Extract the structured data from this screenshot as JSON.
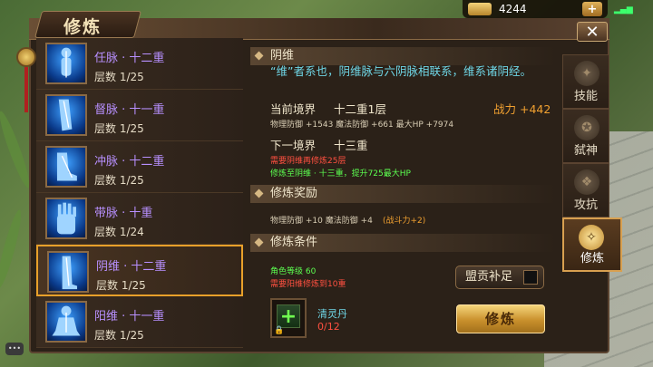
{
  "resources": {
    "gold_value": "4244",
    "plus_label": "+"
  },
  "window": {
    "title": "修炼",
    "close_label": "✕"
  },
  "meridians": [
    {
      "name": "任脉 · 十二重",
      "layer": "层数 1/25",
      "icon": "body-figure"
    },
    {
      "name": "督脉 · 十一重",
      "layer": "层数 1/25",
      "icon": "leg-figure"
    },
    {
      "name": "冲脉 · 十二重",
      "layer": "层数 1/25",
      "icon": "foot-figure"
    },
    {
      "name": "带脉 · 十重",
      "layer": "层数 1/24",
      "icon": "hand-figure"
    },
    {
      "name": "阴维 · 十二重",
      "layer": "层数 1/25",
      "icon": "leg-figure",
      "selected": true
    },
    {
      "name": "阳维 · 十一重",
      "layer": "层数 1/25",
      "icon": "seated-figure"
    }
  ],
  "detail": {
    "section_title": "阴维",
    "description": "“维”者系也，阴维脉与六阴脉相联系，维系诸阴经。",
    "current_label": "当前境界",
    "current_value": "十二重1层",
    "power_label": "战力 +442",
    "current_stats": "物理防御 +1543  魔法防御 +661  最大HP +7974",
    "next_label": "下一境界",
    "next_value": "十三重",
    "requirement": "需要阴维再修炼25层",
    "next_bonus": "修炼至阴维 · 十三重，提升725最大HP"
  },
  "reward": {
    "section_title": "修炼奖励",
    "stats": "物理防御 +10  魔法防御 +4",
    "power": "(战斗力+2)"
  },
  "condition": {
    "section_title": "修炼条件",
    "level": "角色等级  60",
    "requirement": "需要阳维修炼到10重",
    "item_name": "清灵丹",
    "item_count": "0/12",
    "item_slot_plus": "+"
  },
  "buttons": {
    "supplement": "盟贡补足",
    "cultivate": "修炼"
  },
  "tabs": [
    {
      "label": "技能",
      "icon": "skill-icon"
    },
    {
      "label": "弑神",
      "icon": "godslayer-icon"
    },
    {
      "label": "攻抗",
      "icon": "resist-icon"
    },
    {
      "label": "修炼",
      "icon": "cultivate-icon",
      "active": true
    }
  ],
  "colors": {
    "accent": "#e8a02a",
    "name_purple": "#b890ff",
    "desc_cyan": "#6fd6e6",
    "warn_red": "#ff5040",
    "bonus_green": "#5cff50",
    "power_orange": "#f0a030"
  }
}
